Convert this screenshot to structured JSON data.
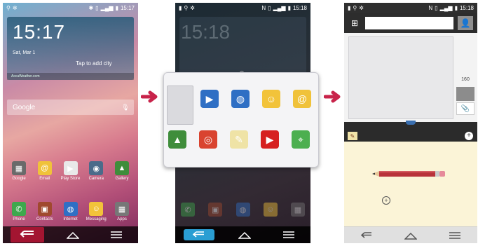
{
  "screen1": {
    "status_time": "15:17",
    "clock": {
      "time": "15:17",
      "date": "Sat, Mar 1",
      "city_prompt": "Tap to add city",
      "footer": "AccuWeather.com"
    },
    "search": {
      "label": "Google"
    },
    "apps_row1": [
      {
        "label": "Google",
        "icon": "google-folder-icon",
        "color": "#6a6a6a"
      },
      {
        "label": "Email",
        "icon": "email-icon",
        "color": "#f0c23a"
      },
      {
        "label": "Play Store",
        "icon": "play-store-icon",
        "color": "#e9e9e9"
      },
      {
        "label": "Camera",
        "icon": "camera-icon",
        "color": "#4a6b8a"
      },
      {
        "label": "Gallery",
        "icon": "gallery-icon",
        "color": "#3f8d3b"
      }
    ],
    "apps_row2": [
      {
        "label": "Phone",
        "icon": "phone-icon",
        "color": "#3ea84d"
      },
      {
        "label": "Contacts",
        "icon": "contacts-icon",
        "color": "#a0492e"
      },
      {
        "label": "Internet",
        "icon": "internet-icon",
        "color": "#2f6fc4"
      },
      {
        "label": "Messaging",
        "icon": "messaging-icon",
        "color": "#f2c33a"
      },
      {
        "label": "Apps",
        "icon": "apps-grid-icon",
        "color": "#777777"
      }
    ]
  },
  "screen2": {
    "status_time": "15:18",
    "dim_clock": "15:18"
  },
  "popup": {
    "apps": [
      {
        "icon": "video-clapper-icon",
        "color": "#2f6fc4"
      },
      {
        "icon": "internet-icon",
        "color": "#2f6fc4"
      },
      {
        "icon": "messaging-icon",
        "color": "#f2c33a"
      },
      {
        "icon": "email-icon",
        "color": "#f0c23a"
      },
      {
        "icon": "gallery-icon",
        "color": "#3f8d3b"
      },
      {
        "icon": "chrome-icon",
        "color": "#d9432f"
      },
      {
        "icon": "qmemo-icon",
        "color": "#efe3a6"
      },
      {
        "icon": "youtube-icon",
        "color": "#d62020"
      },
      {
        "icon": "maps-icon",
        "color": "#4caf50"
      }
    ]
  },
  "screen3": {
    "status_time": "15:18",
    "char_counter": "160"
  },
  "colors": {
    "arrow": "#c8234a",
    "back_highlight": "#a31531",
    "back_glow": "#2a9ed3"
  }
}
